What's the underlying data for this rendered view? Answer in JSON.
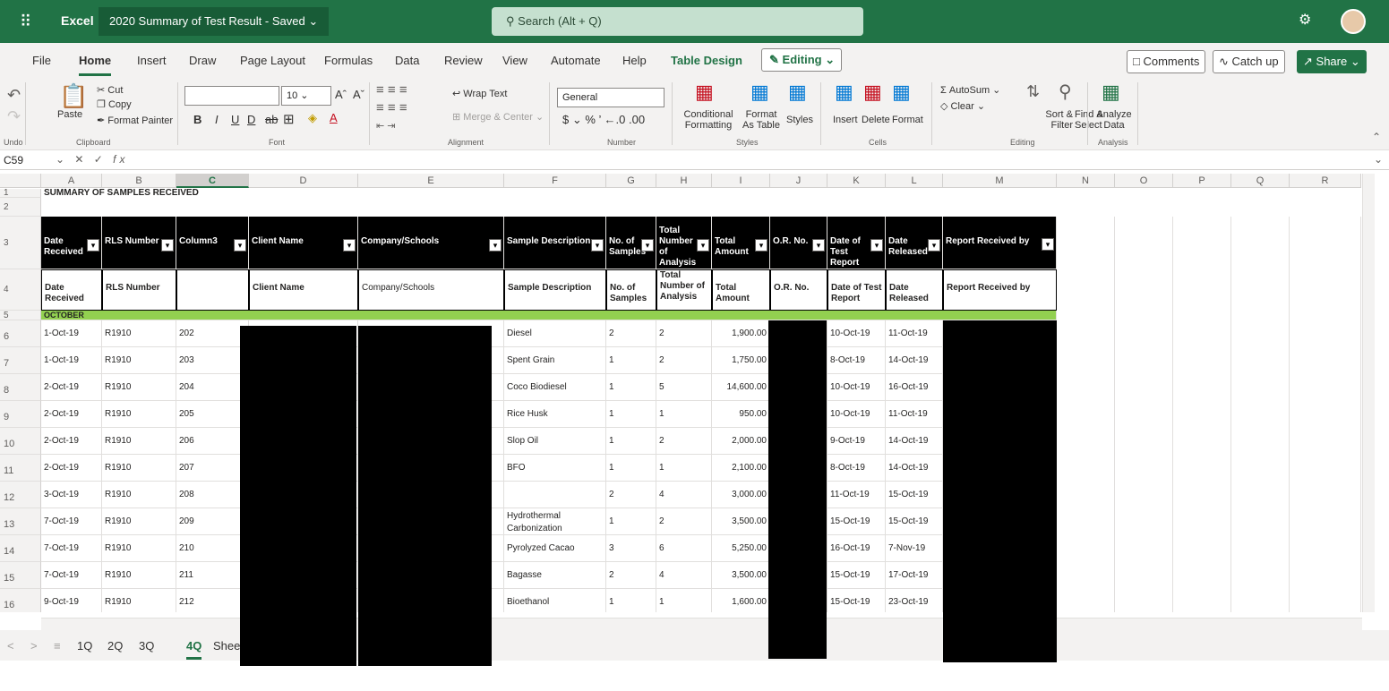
{
  "titlebar": {
    "app": "Excel",
    "doc_title": "2020 Summary of Test Result - Saved",
    "search_placeholder": "Search (Alt + Q)",
    "accent": "#217346"
  },
  "tabs": [
    "File",
    "Home",
    "Insert",
    "Draw",
    "Page Layout",
    "Formulas",
    "Data",
    "Review",
    "View",
    "Automate",
    "Help",
    "Table Design"
  ],
  "editing_label": "Editing",
  "right_buttons": {
    "comments": "Comments",
    "catchup": "Catch up",
    "share": "Share"
  },
  "ribbon": {
    "undo": "Undo",
    "clipboard": {
      "paste": "Paste",
      "cut": "Cut",
      "copy": "Copy",
      "format_painter": "Format Painter",
      "label": "Clipboard"
    },
    "font": {
      "size": "10",
      "label": "Font"
    },
    "alignment": {
      "wrap": "Wrap Text",
      "merge": "Merge & Center",
      "label": "Alignment"
    },
    "number": {
      "format": "General",
      "label": "Number"
    },
    "styles": {
      "conditional": "Conditional Formatting",
      "format_table": "Format As Table",
      "styles": "Styles",
      "label": "Styles"
    },
    "cells": {
      "insert": "Insert",
      "delete": "Delete",
      "format": "Format",
      "label": "Cells"
    },
    "editing": {
      "autosum": "AutoSum",
      "clear": "Clear",
      "sort": "Sort & Filter",
      "find": "Find & Select",
      "label": "Editing"
    },
    "analysis": {
      "analyze": "Analyze Data",
      "label": "Analysis"
    }
  },
  "formula_bar": {
    "name_box": "C59",
    "fx": "fx"
  },
  "grid": {
    "columns": [
      "A",
      "B",
      "C",
      "D",
      "E",
      "F",
      "G",
      "H",
      "I",
      "J",
      "K",
      "L",
      "M",
      "N",
      "O",
      "P",
      "Q",
      "R"
    ],
    "selected_column": "C",
    "row1_title": "SUMMARY OF SAMPLES RECEIVED",
    "header_black": [
      "Date Received",
      "RLS Number",
      "Column3",
      "Client Name",
      "Company/Schools",
      "Sample Description",
      "No. of Samples",
      "Total Number of Analysis",
      "Total Amount",
      "O.R. No.",
      "Date of Test Report",
      "Date Released",
      "Report Received by"
    ],
    "header_white": [
      "Date Received",
      "RLS Number",
      "",
      "Client Name",
      "Company/Schools",
      "Sample Description",
      "No. of Samples",
      "Total Number of Analysis",
      "Total Amount",
      "O.R. No.",
      "Date of Test Report",
      "Date Released",
      "Report Received by"
    ],
    "month": "OCTOBER",
    "rows": [
      {
        "n": "6",
        "a": "1-Oct-19",
        "b": "R1910",
        "c": "202",
        "f": "Diesel",
        "g": "2",
        "h": "2",
        "i": "1,900.00",
        "k": "10-Oct-19",
        "l": "11-Oct-19"
      },
      {
        "n": "7",
        "a": "1-Oct-19",
        "b": "R1910",
        "c": "203",
        "f": "Spent Grain",
        "g": "1",
        "h": "2",
        "i": "1,750.00",
        "k": "8-Oct-19",
        "l": "14-Oct-19"
      },
      {
        "n": "8",
        "a": "2-Oct-19",
        "b": "R1910",
        "c": "204",
        "f": "Coco Biodiesel",
        "g": "1",
        "h": "5",
        "i": "14,600.00",
        "k": "10-Oct-19",
        "l": "16-Oct-19"
      },
      {
        "n": "9",
        "a": "2-Oct-19",
        "b": "R1910",
        "c": "205",
        "f": "Rice Husk",
        "g": "1",
        "h": "1",
        "i": "950.00",
        "k": "10-Oct-19",
        "l": "11-Oct-19"
      },
      {
        "n": "10",
        "a": "2-Oct-19",
        "b": "R1910",
        "c": "206",
        "f": "Slop Oil",
        "g": "1",
        "h": "2",
        "i": "2,000.00",
        "k": "9-Oct-19",
        "l": "14-Oct-19"
      },
      {
        "n": "11",
        "a": "2-Oct-19",
        "b": "R1910",
        "c": "207",
        "f": "BFO",
        "g": "1",
        "h": "1",
        "i": "2,100.00",
        "k": "8-Oct-19",
        "l": "14-Oct-19"
      },
      {
        "n": "12",
        "a": "3-Oct-19",
        "b": "R1910",
        "c": "208",
        "f": "",
        "g": "2",
        "h": "4",
        "i": "3,000.00",
        "k": "11-Oct-19",
        "l": "15-Oct-19"
      },
      {
        "n": "13",
        "a": "7-Oct-19",
        "b": "R1910",
        "c": "209",
        "f": "Hydrothermal Carbonization",
        "g": "1",
        "h": "2",
        "i": "3,500.00",
        "k": "15-Oct-19",
        "l": "15-Oct-19"
      },
      {
        "n": "14",
        "a": "7-Oct-19",
        "b": "R1910",
        "c": "210",
        "f": "Pyrolyzed Cacao",
        "g": "3",
        "h": "6",
        "i": "5,250.00",
        "k": "16-Oct-19",
        "l": "7-Nov-19"
      },
      {
        "n": "15",
        "a": "7-Oct-19",
        "b": "R1910",
        "c": "211",
        "f": "Bagasse",
        "g": "2",
        "h": "4",
        "i": "3,500.00",
        "k": "15-Oct-19",
        "l": "17-Oct-19"
      },
      {
        "n": "16",
        "a": "9-Oct-19",
        "b": "R1910",
        "c": "212",
        "f": "Bioethanol",
        "g": "1",
        "h": "1",
        "i": "1,600.00",
        "k": "15-Oct-19",
        "l": "23-Oct-19"
      }
    ]
  },
  "sheet_tabs": [
    "1Q",
    "2Q",
    "3Q",
    "4Q",
    "Shee"
  ],
  "active_sheet": "4Q"
}
